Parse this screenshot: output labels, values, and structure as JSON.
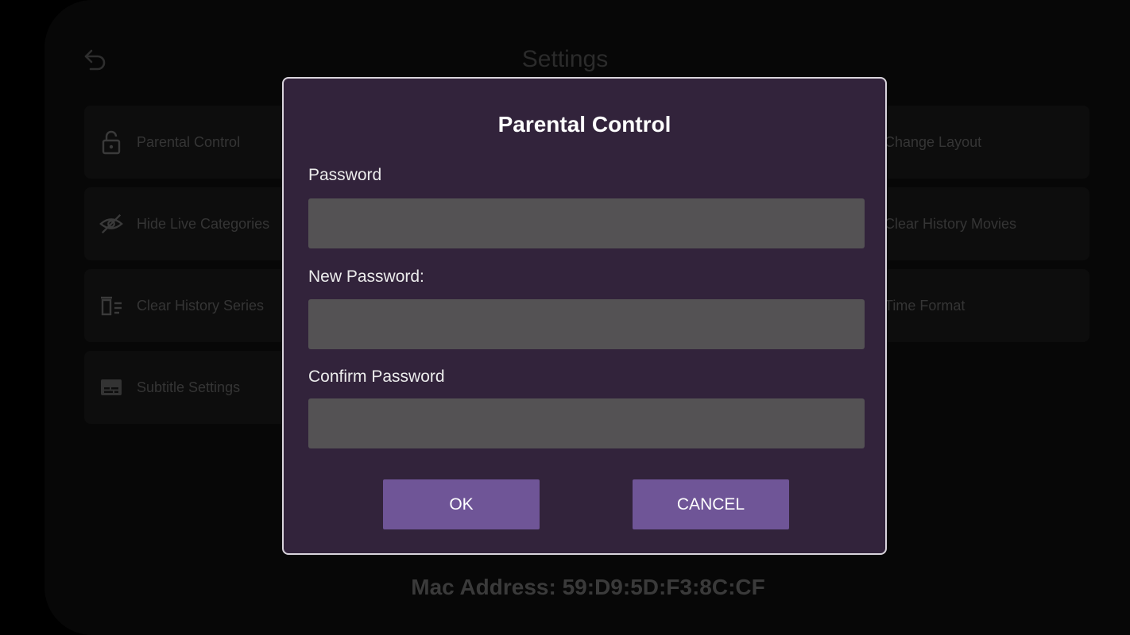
{
  "background": {
    "title": "Settings",
    "back_icon": "back-arrow-icon",
    "left_items": [
      {
        "label": "Parental Control",
        "icon": "lock-icon"
      },
      {
        "label": "Hide Live Categories",
        "icon": "eye-off-icon"
      },
      {
        "label": "Clear History Series",
        "icon": "trash-list-icon"
      },
      {
        "label": "Subtitle Settings",
        "icon": "subtitles-icon"
      }
    ],
    "right_items": [
      {
        "label": "Change Layout"
      },
      {
        "label": "Clear History Movies"
      },
      {
        "label": "Time Format"
      }
    ],
    "mac_address": "Mac Address: 59:D9:5D:F3:8C:CF"
  },
  "dialog": {
    "title": "Parental Control",
    "password_label": "Password",
    "password_value": "",
    "new_password_label": "New Password:",
    "new_password_value": "",
    "confirm_password_label": "Confirm Password",
    "confirm_password_value": "",
    "ok_label": "OK",
    "cancel_label": "CANCEL"
  },
  "colors": {
    "dialog_bg": "#32233b",
    "button_bg": "#6f5597",
    "field_bg": "#545254"
  }
}
